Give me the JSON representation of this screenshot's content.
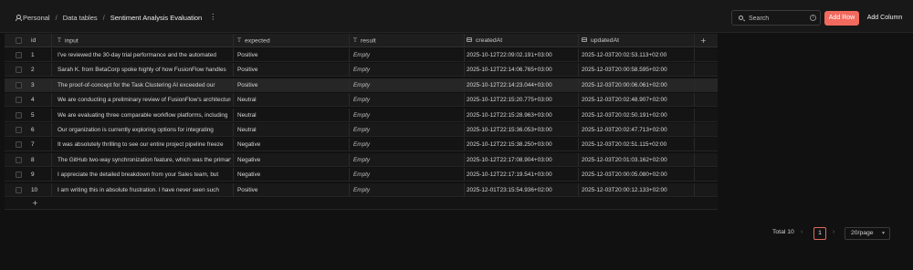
{
  "breadcrumb": {
    "items": [
      "Personal",
      "Data tables",
      "Sentiment Analysis Evaluation"
    ],
    "separator": "/"
  },
  "toolbar": {
    "search_placeholder": "Search",
    "add_row": "Add Row",
    "add_column": "Add Column"
  },
  "table": {
    "columns": [
      "id",
      "input",
      "expected",
      "result",
      "createdAt",
      "updatedAt"
    ],
    "rows": [
      {
        "id": "1",
        "input": "I've reviewed the 30-day trial performance and the automated",
        "expected": "Positive",
        "result": "Empty",
        "createdAt": "2025-10-12T22:09:02.191+03:00",
        "updatedAt": "2025-12-03T20:02:53.113+02:00"
      },
      {
        "id": "2",
        "input": "Sarah K. from BetaCorp spoke highly of how FusionFlow handles",
        "expected": "Positive",
        "result": "Empty",
        "createdAt": "2025-10-12T22:14:06.765+03:00",
        "updatedAt": "2025-12-03T20:00:58.595+02:00"
      },
      {
        "id": "3",
        "input": "The proof-of-concept for the Task Clustering AI exceeded our",
        "expected": "Positive",
        "result": "Empty",
        "createdAt": "2025-10-12T22:14:23.044+03:00",
        "updatedAt": "2025-12-03T20:00:06.061+02:00"
      },
      {
        "id": "4",
        "input": "We are conducting a preliminary review of FusionFlow's architecture",
        "expected": "Neutral",
        "result": "Empty",
        "createdAt": "2025-10-12T22:15:20.775+03:00",
        "updatedAt": "2025-12-03T20:02:48.907+02:00"
      },
      {
        "id": "5",
        "input": "We are evaluating three comparable workflow platforms, including",
        "expected": "Neutral",
        "result": "Empty",
        "createdAt": "2025-10-12T22:15:28.963+03:00",
        "updatedAt": "2025-12-03T20:02:50.191+02:00"
      },
      {
        "id": "6",
        "input": "Our organization is currently exploring options for integrating",
        "expected": "Neutral",
        "result": "Empty",
        "createdAt": "2025-10-12T22:15:36.053+03:00",
        "updatedAt": "2025-12-03T20:02:47.713+02:00"
      },
      {
        "id": "7",
        "input": "It was absolutely thrilling to see our entire project pipeline freeze",
        "expected": "Negative",
        "result": "Empty",
        "createdAt": "2025-10-12T22:15:38.250+03:00",
        "updatedAt": "2025-12-03T20:02:51.115+02:00"
      },
      {
        "id": "8",
        "input": "The GitHub two-way synchronization feature, which was the primary",
        "expected": "Negative",
        "result": "Empty",
        "createdAt": "2025-10-12T22:17:08.904+03:00",
        "updatedAt": "2025-12-03T20:01:03.162+02:00"
      },
      {
        "id": "9",
        "input": "I appreciate the detailed breakdown from your Sales team, but",
        "expected": "Negative",
        "result": "Empty",
        "createdAt": "2025-10-12T22:17:19.541+03:00",
        "updatedAt": "2025-12-03T20:00:05.080+02:00"
      },
      {
        "id": "10",
        "input": "I am writing this in absolute frustration. I have never seen such",
        "expected": "Positive",
        "result": "Empty",
        "createdAt": "2025-12-01T23:15:54.936+02:00",
        "updatedAt": "2025-12-03T20:00:12.133+02:00"
      }
    ],
    "add_column_glyph": "+",
    "add_row_glyph": "+"
  },
  "pagination": {
    "total": "Total 10",
    "current_page": "1",
    "page_size": "20/page",
    "prev_glyph": "‹",
    "next_glyph": "›"
  },
  "colors": {
    "accent": "#f26a5e",
    "background": "#111111",
    "header_bg": "#181818"
  }
}
